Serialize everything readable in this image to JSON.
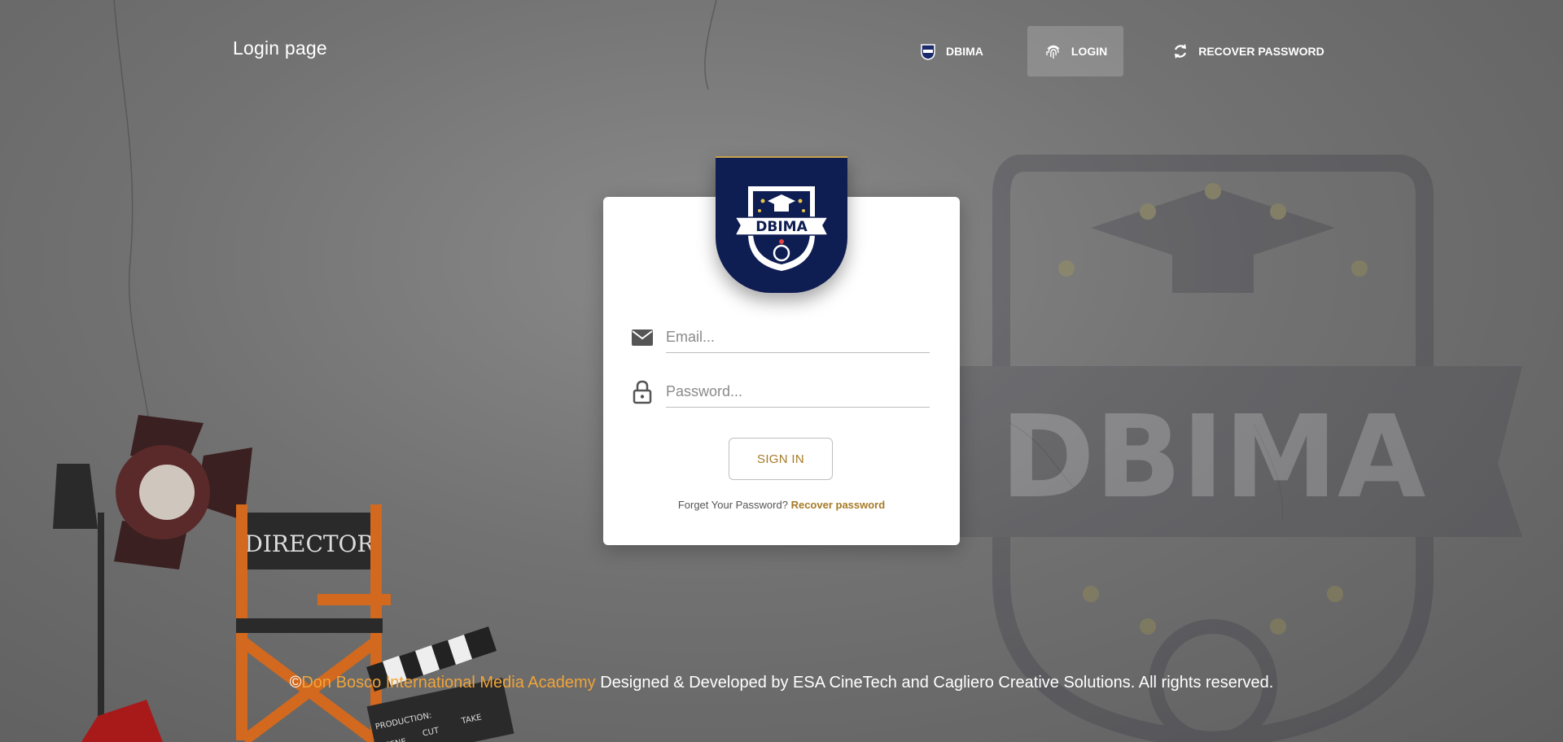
{
  "header": {
    "title": "Login page",
    "nav": [
      {
        "label": "DBIMA",
        "icon": "crest-icon",
        "active": false
      },
      {
        "label": "LOGIN",
        "icon": "fingerprint-icon",
        "active": true
      },
      {
        "label": "RECOVER PASSWORD",
        "icon": "refresh-icon",
        "active": false
      }
    ]
  },
  "logo": {
    "text": "DBIMA"
  },
  "form": {
    "email": {
      "placeholder": "Email...",
      "value": "",
      "icon": "mail-icon"
    },
    "password": {
      "placeholder": "Password...",
      "value": "",
      "icon": "lock-icon"
    },
    "signin_label": "SIGN IN",
    "forgot_text": "Forget Your Password?",
    "recover_link": "Recover password"
  },
  "background": {
    "watermark_text": "DBIMA",
    "director_chair_text": "DIRECTOR",
    "clapper_labels": [
      "PRODUCTION:",
      "SCENE",
      "CUT",
      "TAKE"
    ]
  },
  "footer": {
    "copyright_symbol": "©",
    "academy": "Don Bosco International Media Academy",
    "rest": " Designed & Developed by ESA CineTech and Cagliero Creative Solutions. All rights reserved."
  },
  "colors": {
    "accent": "#a67a26",
    "navy": "#0e1d52",
    "footer_link": "#f0a43a"
  }
}
